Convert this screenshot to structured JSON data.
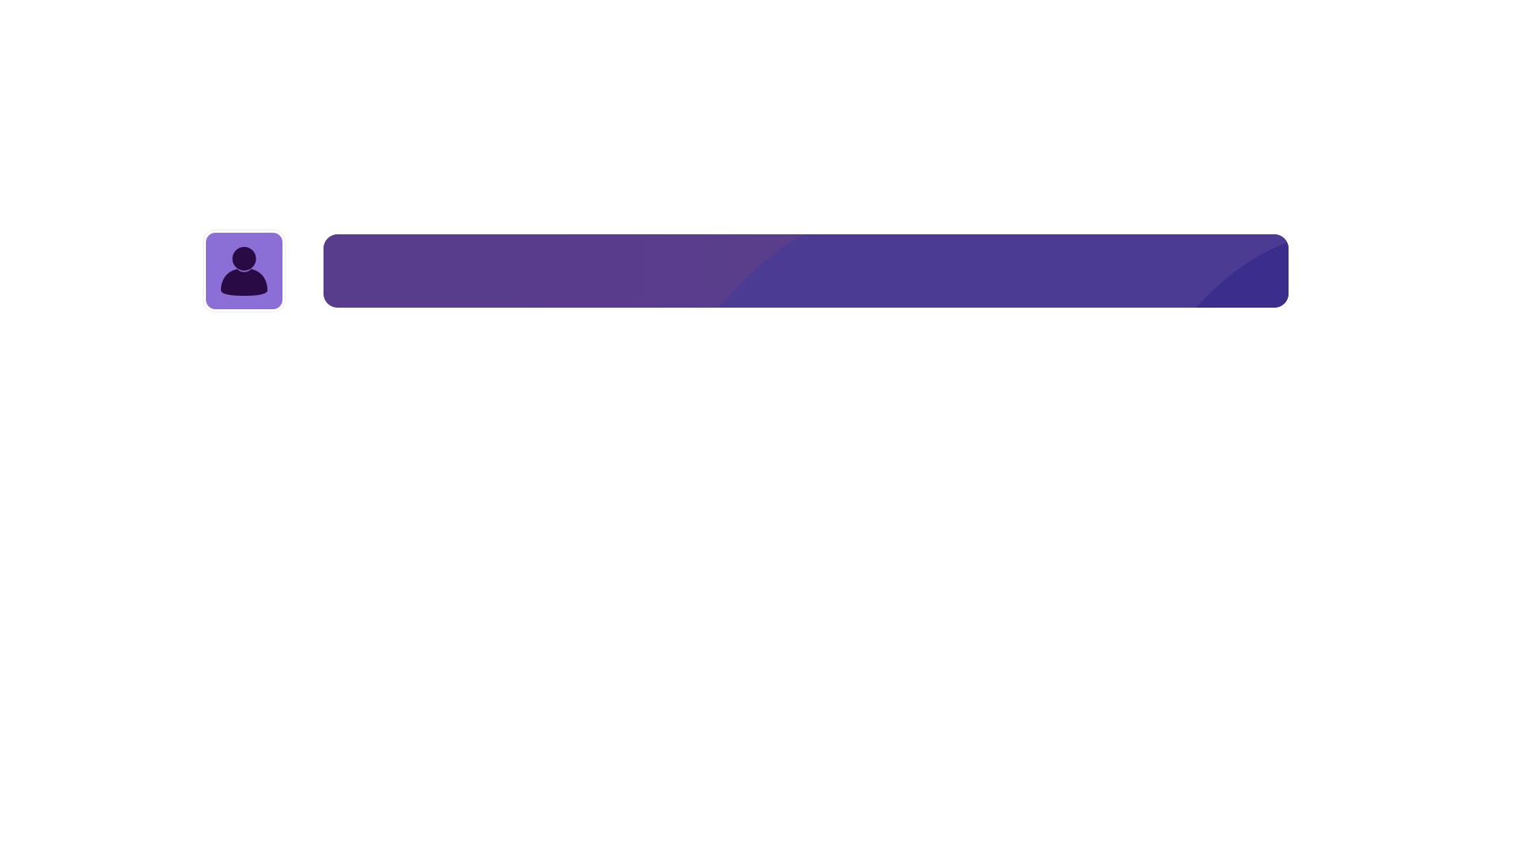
{
  "profile": {
    "avatar_icon": "user-icon",
    "tile_color": "#8b6fd6",
    "figure_color": "#2a0a45"
  },
  "banner": {
    "text": "",
    "colors": {
      "left": "#5a3f8d",
      "middle": "#4c3b93",
      "right": "#3a2d8c"
    }
  }
}
